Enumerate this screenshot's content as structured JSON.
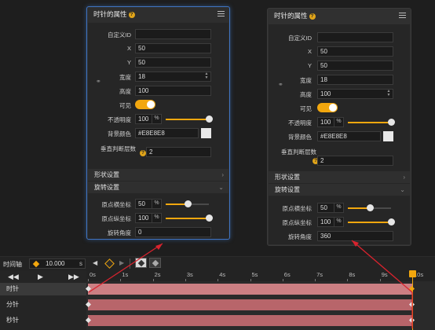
{
  "panel_left": {
    "title": "时针的属性",
    "fields": {
      "custom_id_label": "自定义ID",
      "custom_id_value": "",
      "x_label": "X",
      "x_value": "50",
      "y_label": "Y",
      "y_value": "50",
      "width_label": "宽度",
      "width_value": "18",
      "height_label": "高度",
      "height_value": "100",
      "visible_label": "可见",
      "visible": true,
      "opacity_label": "不透明度",
      "opacity_value": "100",
      "opacity_unit": "%",
      "opacity_level": 1.0,
      "bg_label": "背景颜色",
      "bg_value": "#E8E8E8",
      "hitlayer_label": "垂直判断层数",
      "hitlayer_value": "2"
    },
    "sections": {
      "shape": "形状设置",
      "rotate": "旋转设置"
    },
    "rotate": {
      "origin_x_label": "原点横坐标",
      "origin_x_value": "50",
      "origin_x_unit": "%",
      "origin_x_level": 0.5,
      "origin_y_label": "原点纵坐标",
      "origin_y_value": "100",
      "origin_y_unit": "%",
      "origin_y_level": 1.0,
      "angle_label": "旋转角度",
      "angle_value": "0"
    }
  },
  "panel_right": {
    "title": "时针的属性",
    "fields": {
      "custom_id_label": "自定义ID",
      "custom_id_value": "",
      "x_label": "X",
      "x_value": "50",
      "y_label": "Y",
      "y_value": "50",
      "width_label": "宽度",
      "width_value": "18",
      "height_label": "高度",
      "height_value": "100",
      "visible_label": "可见",
      "visible": true,
      "opacity_label": "不透明度",
      "opacity_value": "100",
      "opacity_unit": "%",
      "opacity_level": 1.0,
      "bg_label": "背景颜色",
      "bg_value": "#E8E8E8",
      "hitlayer_label": "垂直判断层数",
      "hitlayer_value": "2"
    },
    "sections": {
      "shape": "形状设置",
      "rotate": "旋转设置"
    },
    "rotate": {
      "origin_x_label": "原点横坐标",
      "origin_x_value": "50",
      "origin_x_unit": "%",
      "origin_x_level": 0.5,
      "origin_y_label": "原点纵坐标",
      "origin_y_value": "100",
      "origin_y_unit": "%",
      "origin_y_level": 1.0,
      "angle_label": "旋转角度",
      "angle_value": "360"
    }
  },
  "timeline": {
    "label": "时间轴",
    "duration": "10.000",
    "duration_unit": "s",
    "ticks": [
      "0s",
      "1s",
      "2s",
      "3s",
      "4s",
      "5s",
      "6s",
      "7s",
      "8s",
      "9s",
      "10s"
    ],
    "rows": [
      "时针",
      "分针",
      "秒针"
    ],
    "selected_row": 0
  },
  "colors": {
    "accent": "#f2a70e",
    "track": "#b8656a",
    "selection": "#3f74c2",
    "arrow": "#d9232e"
  }
}
